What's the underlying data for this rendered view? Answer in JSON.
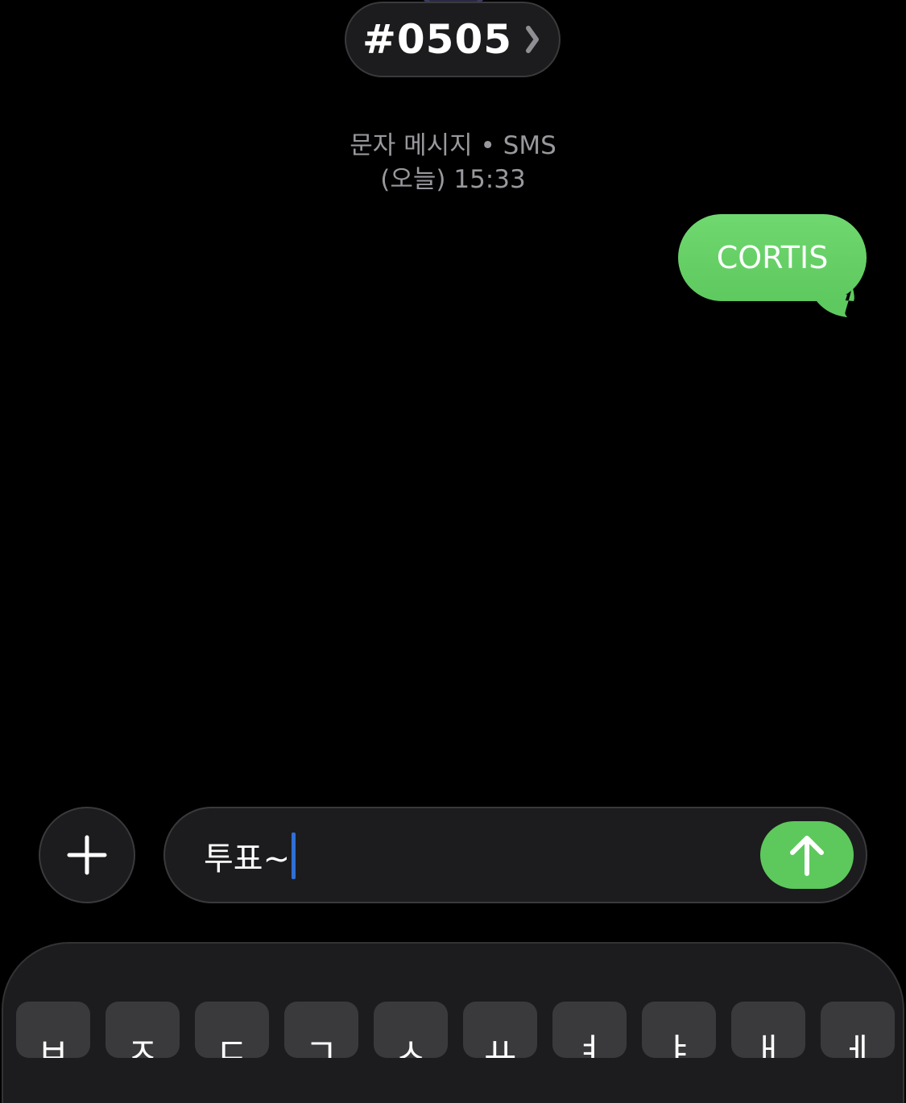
{
  "header": {
    "contact_name": "#0505",
    "chevron_icon": "chevron-right-icon"
  },
  "conversation": {
    "service_label": "문자 메시지 • SMS",
    "timestamp": "(오늘) 15:33",
    "messages": [
      {
        "direction": "outgoing",
        "text": "CORTIS"
      }
    ]
  },
  "composer": {
    "plus_icon": "plus-icon",
    "input_value": "투표~",
    "send_icon": "arrow-up-icon"
  },
  "keyboard": {
    "visible_top_row_keys": [
      "ㅂ",
      "ㅈ",
      "ㄷ",
      "ㄱ",
      "ㅅ",
      "ㅛ",
      "ㅕ",
      "ㅑ",
      "ㅐ",
      "ㅔ"
    ]
  },
  "colors": {
    "background": "#000000",
    "bubble_green": "#5ec95f",
    "send_green": "#5dc95c",
    "cursor_blue": "#2f6fd6",
    "secondary_text": "#98989d",
    "control_fill": "#1c1c1e"
  }
}
